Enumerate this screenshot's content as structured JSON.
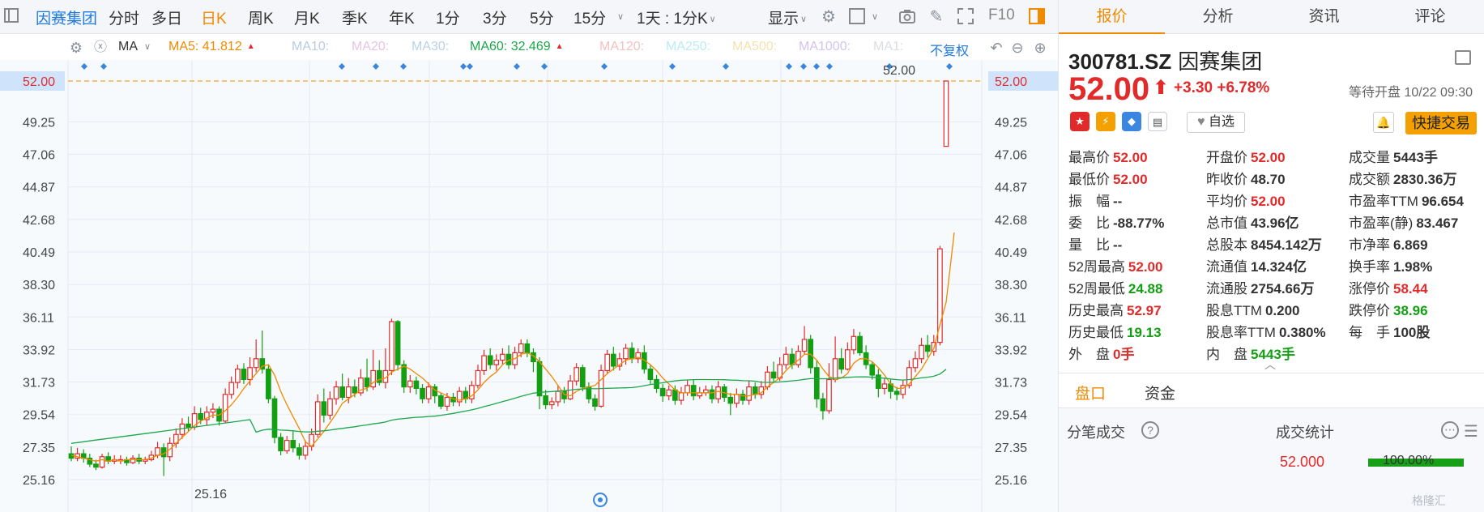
{
  "toolbar": {
    "items": [
      "因赛集团",
      "分时",
      "多日",
      "日K",
      "周K",
      "月K",
      "季K",
      "年K",
      "1分",
      "3分",
      "5分",
      "15分"
    ],
    "active": "日K",
    "period_select": "1天 : 1分K",
    "display": "显示",
    "f10": "F10"
  },
  "ma": {
    "label": "MA",
    "items": [
      {
        "text": "MA5: 41.812",
        "color": "#f08a00",
        "tri": "▲"
      },
      {
        "text": "MA10:",
        "color": "#b9cbe6",
        "tri": ""
      },
      {
        "text": "MA20:",
        "color": "#e6c4e6",
        "tri": ""
      },
      {
        "text": "MA30:",
        "color": "#b9d2e6",
        "tri": ""
      },
      {
        "text": "MA60: 32.469",
        "color": "#1aa84a",
        "tri": "▲"
      },
      {
        "text": "MA120:",
        "color": "#f4c2c2",
        "tri": ""
      },
      {
        "text": "MA250:",
        "color": "#b9ecf4",
        "tri": ""
      },
      {
        "text": "MA500:",
        "color": "#f4e2b0",
        "tri": ""
      },
      {
        "text": "MA1000:",
        "color": "#d2c4ec",
        "tri": ""
      },
      {
        "text": "MA1:",
        "color": "#dadde2",
        "tri": ""
      }
    ],
    "fuquan": "不复权"
  },
  "chart_data": {
    "type": "candlestick",
    "price_line": "52.00",
    "y_ticks": [
      "52.00",
      "49.25",
      "47.06",
      "44.87",
      "42.68",
      "40.49",
      "38.30",
      "36.11",
      "33.92",
      "31.73",
      "29.54",
      "27.35",
      "25.16"
    ],
    "max_label": "52.00",
    "min_label": "25.16",
    "ylim": [
      25.16,
      52.0
    ],
    "colors": {
      "up": "#e12b2b",
      "down": "#12a012",
      "ma5": "#f08a00",
      "ma60": "#1aa84a"
    },
    "ohlc": [
      [
        26.9,
        26.6,
        27.4,
        26.4
      ],
      [
        26.6,
        26.9,
        27.3,
        26.4
      ],
      [
        26.9,
        26.6,
        27.2,
        26.3
      ],
      [
        26.6,
        26.2,
        26.9,
        26.0
      ],
      [
        26.2,
        26.0,
        26.5,
        25.8
      ],
      [
        26.0,
        26.7,
        26.9,
        25.9
      ],
      [
        26.7,
        26.4,
        27.0,
        26.2
      ],
      [
        26.4,
        26.5,
        26.8,
        26.2
      ],
      [
        26.5,
        26.5,
        26.8,
        26.2
      ],
      [
        26.5,
        26.3,
        26.7,
        26.1
      ],
      [
        26.3,
        26.6,
        26.8,
        26.2
      ],
      [
        26.6,
        26.4,
        26.9,
        26.2
      ],
      [
        26.4,
        26.5,
        26.7,
        26.2
      ],
      [
        26.5,
        26.8,
        27.1,
        26.4
      ],
      [
        26.8,
        27.3,
        27.7,
        26.6
      ],
      [
        27.3,
        26.7,
        27.6,
        25.4
      ],
      [
        26.7,
        27.6,
        28.0,
        26.4
      ],
      [
        27.6,
        28.2,
        28.6,
        27.3
      ],
      [
        28.2,
        28.9,
        29.3,
        27.9
      ],
      [
        28.9,
        28.7,
        29.4,
        28.4
      ],
      [
        28.7,
        29.6,
        30.1,
        28.5
      ],
      [
        29.6,
        29.2,
        30.0,
        28.9
      ],
      [
        29.2,
        29.7,
        30.1,
        28.8
      ],
      [
        29.7,
        29.9,
        30.3,
        29.3
      ],
      [
        29.9,
        29.1,
        30.1,
        28.8
      ],
      [
        29.1,
        30.9,
        31.3,
        29.0
      ],
      [
        30.9,
        31.7,
        32.1,
        30.6
      ],
      [
        31.7,
        32.6,
        32.9,
        31.3
      ],
      [
        32.6,
        31.9,
        33.0,
        31.6
      ],
      [
        31.9,
        32.7,
        33.4,
        31.5
      ],
      [
        32.7,
        33.3,
        34.6,
        32.4
      ],
      [
        33.3,
        32.6,
        35.2,
        32.3
      ],
      [
        32.6,
        30.6,
        32.9,
        30.3
      ],
      [
        30.6,
        28.0,
        30.8,
        27.6
      ],
      [
        28.0,
        27.1,
        28.3,
        26.8
      ],
      [
        27.1,
        27.8,
        28.1,
        26.9
      ],
      [
        27.8,
        27.3,
        28.4,
        27.0
      ],
      [
        27.3,
        26.8,
        27.6,
        26.5
      ],
      [
        26.8,
        27.4,
        27.8,
        26.5
      ],
      [
        27.4,
        28.2,
        28.6,
        27.1
      ],
      [
        28.2,
        30.4,
        30.9,
        28.0
      ],
      [
        30.4,
        29.5,
        31.3,
        29.0
      ],
      [
        29.5,
        30.6,
        31.1,
        29.2
      ],
      [
        30.6,
        31.4,
        31.8,
        30.2
      ],
      [
        31.4,
        30.7,
        32.3,
        30.5
      ],
      [
        30.7,
        31.4,
        32.0,
        30.3
      ],
      [
        31.4,
        31.0,
        31.9,
        30.7
      ],
      [
        31.0,
        32.0,
        32.6,
        30.8
      ],
      [
        32.0,
        31.4,
        33.3,
        31.1
      ],
      [
        31.4,
        32.5,
        33.9,
        31.2
      ],
      [
        32.5,
        31.7,
        33.2,
        31.5
      ],
      [
        31.7,
        32.5,
        34.0,
        31.3
      ],
      [
        32.5,
        35.8,
        36.0,
        32.2
      ],
      [
        35.8,
        32.9,
        35.9,
        32.5
      ],
      [
        32.9,
        31.4,
        33.2,
        31.0
      ],
      [
        31.4,
        31.8,
        32.2,
        31.0
      ],
      [
        31.8,
        31.3,
        32.1,
        30.9
      ],
      [
        31.3,
        30.6,
        31.6,
        30.3
      ],
      [
        30.6,
        31.4,
        31.7,
        30.3
      ],
      [
        31.4,
        30.8,
        31.6,
        30.3
      ],
      [
        30.8,
        30.1,
        31.0,
        29.9
      ],
      [
        30.1,
        30.7,
        31.0,
        29.8
      ],
      [
        30.7,
        30.4,
        31.0,
        30.1
      ],
      [
        30.4,
        31.1,
        31.4,
        30.1
      ],
      [
        31.1,
        30.6,
        31.4,
        30.3
      ],
      [
        30.6,
        31.5,
        31.8,
        30.3
      ],
      [
        31.5,
        32.5,
        32.9,
        31.3
      ],
      [
        32.5,
        33.5,
        33.9,
        32.2
      ],
      [
        33.5,
        32.9,
        34.0,
        32.6
      ],
      [
        32.9,
        33.2,
        33.6,
        32.5
      ],
      [
        33.2,
        33.6,
        34.0,
        32.9
      ],
      [
        33.6,
        32.9,
        34.2,
        32.6
      ],
      [
        32.9,
        33.7,
        34.1,
        32.6
      ],
      [
        33.7,
        34.3,
        34.6,
        33.4
      ],
      [
        34.3,
        33.7,
        34.6,
        33.4
      ],
      [
        33.7,
        33.1,
        34.0,
        32.4
      ],
      [
        33.1,
        30.8,
        33.4,
        29.9
      ],
      [
        30.8,
        30.2,
        31.2,
        29.9
      ],
      [
        30.2,
        30.4,
        30.7,
        29.9
      ],
      [
        30.4,
        31.1,
        31.5,
        30.1
      ],
      [
        31.1,
        30.6,
        31.4,
        30.3
      ],
      [
        30.6,
        31.8,
        32.2,
        30.5
      ],
      [
        31.8,
        32.7,
        33.0,
        31.5
      ],
      [
        32.7,
        31.4,
        32.9,
        31.1
      ],
      [
        31.4,
        30.6,
        31.7,
        30.3
      ],
      [
        30.6,
        30.1,
        30.9,
        29.8
      ],
      [
        30.1,
        32.5,
        32.9,
        30.0
      ],
      [
        32.5,
        33.6,
        33.9,
        32.3
      ],
      [
        33.6,
        32.8,
        34.1,
        32.5
      ],
      [
        32.8,
        33.3,
        33.7,
        32.5
      ],
      [
        33.3,
        34.0,
        34.3,
        32.9
      ],
      [
        34.0,
        33.3,
        34.4,
        33.0
      ],
      [
        33.3,
        33.7,
        34.0,
        33.0
      ],
      [
        33.7,
        32.6,
        34.2,
        32.3
      ],
      [
        32.6,
        31.9,
        32.9,
        31.6
      ],
      [
        31.9,
        31.3,
        32.2,
        31.0
      ],
      [
        31.3,
        30.8,
        31.6,
        30.4
      ],
      [
        30.8,
        31.2,
        31.5,
        30.5
      ],
      [
        31.2,
        30.5,
        31.5,
        30.2
      ],
      [
        30.5,
        31.0,
        31.4,
        30.2
      ],
      [
        31.0,
        31.5,
        31.9,
        30.8
      ],
      [
        31.5,
        30.8,
        31.9,
        30.5
      ],
      [
        30.8,
        31.0,
        31.4,
        30.6
      ],
      [
        31.0,
        31.2,
        31.5,
        30.8
      ],
      [
        31.2,
        30.6,
        31.5,
        30.3
      ],
      [
        30.6,
        31.4,
        31.8,
        30.3
      ],
      [
        31.4,
        30.7,
        31.6,
        30.4
      ],
      [
        30.7,
        30.3,
        31.0,
        29.5
      ],
      [
        30.3,
        30.9,
        31.3,
        30.0
      ],
      [
        30.9,
        30.5,
        31.2,
        30.2
      ],
      [
        30.5,
        31.4,
        31.8,
        30.2
      ],
      [
        31.4,
        30.9,
        31.7,
        30.6
      ],
      [
        30.9,
        31.4,
        31.8,
        30.6
      ],
      [
        31.4,
        32.4,
        32.8,
        31.2
      ],
      [
        32.4,
        32.0,
        33.1,
        31.7
      ],
      [
        32.0,
        32.9,
        33.4,
        31.8
      ],
      [
        32.9,
        33.6,
        34.1,
        32.6
      ],
      [
        33.6,
        32.9,
        34.0,
        32.6
      ],
      [
        32.9,
        33.8,
        34.2,
        32.7
      ],
      [
        33.8,
        34.6,
        35.5,
        33.6
      ],
      [
        34.6,
        32.7,
        34.9,
        32.3
      ],
      [
        32.7,
        30.6,
        33.2,
        30.0
      ],
      [
        30.6,
        29.8,
        31.0,
        29.2
      ],
      [
        29.8,
        31.9,
        33.0,
        29.6
      ],
      [
        31.9,
        33.3,
        34.8,
        31.7
      ],
      [
        33.3,
        32.6,
        34.0,
        32.3
      ],
      [
        32.6,
        33.9,
        34.4,
        32.5
      ],
      [
        33.9,
        34.8,
        35.3,
        33.6
      ],
      [
        34.8,
        33.7,
        35.1,
        33.5
      ],
      [
        33.7,
        32.9,
        34.2,
        32.6
      ],
      [
        32.9,
        32.2,
        33.1,
        31.9
      ],
      [
        32.2,
        31.3,
        32.6,
        30.7
      ],
      [
        31.3,
        31.6,
        32.0,
        30.9
      ],
      [
        31.6,
        31.1,
        31.9,
        30.6
      ],
      [
        31.1,
        30.9,
        31.4,
        30.5
      ],
      [
        30.9,
        31.5,
        31.9,
        30.6
      ],
      [
        31.5,
        32.7,
        33.2,
        31.3
      ],
      [
        32.7,
        33.3,
        33.8,
        32.4
      ],
      [
        33.3,
        34.2,
        34.7,
        33.0
      ],
      [
        34.2,
        33.8,
        34.9,
        33.4
      ],
      [
        33.8,
        34.4,
        34.9,
        33.5
      ],
      [
        34.4,
        40.7,
        40.9,
        34.2
      ],
      [
        47.6,
        52.0,
        52.0,
        47.6
      ]
    ],
    "ma5": [
      26.8,
      26.7,
      26.6,
      26.5,
      26.4,
      26.5,
      26.4,
      26.5,
      26.4,
      26.5,
      26.5,
      26.5,
      26.5,
      26.6,
      26.8,
      26.9,
      27.2,
      27.6,
      28.0,
      28.4,
      28.8,
      29.1,
      29.3,
      29.5,
      29.5,
      29.8,
      30.2,
      30.7,
      31.3,
      31.8,
      32.3,
      32.8,
      32.9,
      32.2,
      31.1,
      30.2,
      29.4,
      28.6,
      27.7,
      27.4,
      27.9,
      28.4,
      29.0,
      29.6,
      30.3,
      30.6,
      30.9,
      31.2,
      31.3,
      31.7,
      31.9,
      32.0,
      32.4,
      32.6,
      32.8,
      32.6,
      32.3,
      32.0,
      31.6,
      31.2,
      31.0,
      30.8,
      30.6,
      30.5,
      30.6,
      30.8,
      31.2,
      31.7,
      32.1,
      32.4,
      32.9,
      33.2,
      33.3,
      33.6,
      33.7,
      33.5,
      33.1,
      32.6,
      32.1,
      31.5,
      30.9,
      30.8,
      31.1,
      31.3,
      31.4,
      31.5,
      31.9,
      32.3,
      32.6,
      32.9,
      33.2,
      33.3,
      33.4,
      33.2,
      32.9,
      32.5,
      32.0,
      31.6,
      31.2,
      31.0,
      31.0,
      31.0,
      31.0,
      31.0,
      31.0,
      31.1,
      31.0,
      30.9,
      30.9,
      30.8,
      30.8,
      30.9,
      31.0,
      31.4,
      31.7,
      32.0,
      32.5,
      32.9,
      33.2,
      33.6,
      33.6,
      33.2,
      32.6,
      32.1,
      31.9,
      32.0,
      32.3,
      33.0,
      33.3,
      33.3,
      33.1,
      32.7,
      32.2,
      31.6,
      31.3,
      31.3,
      31.6,
      32.1,
      32.6,
      33.3,
      34.0,
      35.6,
      37.1
    ]
  },
  "right": {
    "tabs": [
      "报价",
      "分析",
      "资讯",
      "评论"
    ],
    "active_tab": "报价",
    "code": "300781.SZ",
    "name": "因赛集团",
    "price": "52.00",
    "change": "+3.30",
    "change_pct": "+6.78%",
    "status": "等待开盘 10/22 09:30",
    "zixuan": "自选",
    "trade": "快捷交易",
    "grid": [
      [
        {
          "l": "最高价",
          "v": "52.00",
          "c": "red"
        },
        {
          "l": "开盘价",
          "v": "52.00",
          "c": "red"
        },
        {
          "l": "成交量",
          "v": "5443手",
          "c": ""
        }
      ],
      [
        {
          "l": "最低价",
          "v": "52.00",
          "c": "red"
        },
        {
          "l": "昨收价",
          "v": "48.70",
          "c": ""
        },
        {
          "l": "成交额",
          "v": "2830.36万",
          "c": ""
        }
      ],
      [
        {
          "l": "振　幅",
          "v": "--",
          "c": ""
        },
        {
          "l": "平均价",
          "v": "52.00",
          "c": "red"
        },
        {
          "l": "市盈率TTM",
          "v": "96.654",
          "c": ""
        }
      ],
      [
        {
          "l": "委　比",
          "v": "-88.77%",
          "c": ""
        },
        {
          "l": "总市值",
          "v": "43.96亿",
          "c": ""
        },
        {
          "l": "市盈率(静)",
          "v": "83.467",
          "c": ""
        }
      ],
      [
        {
          "l": "量　比",
          "v": "--",
          "c": ""
        },
        {
          "l": "总股本",
          "v": "8454.142万",
          "c": ""
        },
        {
          "l": "市净率",
          "v": "6.869",
          "c": ""
        }
      ],
      [
        {
          "l": "52周最高",
          "v": "52.00",
          "c": "red"
        },
        {
          "l": "流通值",
          "v": "14.324亿",
          "c": ""
        },
        {
          "l": "换手率",
          "v": "1.98%",
          "c": ""
        }
      ],
      [
        {
          "l": "52周最低",
          "v": "24.88",
          "c": "green"
        },
        {
          "l": "流通股",
          "v": "2754.66万",
          "c": ""
        },
        {
          "l": "涨停价",
          "v": "58.44",
          "c": "red"
        }
      ],
      [
        {
          "l": "历史最高",
          "v": "52.97",
          "c": "red"
        },
        {
          "l": "股息TTM",
          "v": "0.200",
          "c": ""
        },
        {
          "l": "跌停价",
          "v": "38.96",
          "c": "green"
        }
      ],
      [
        {
          "l": "历史最低",
          "v": "19.13",
          "c": "green"
        },
        {
          "l": "股息率TTM",
          "v": "0.380%",
          "c": ""
        },
        {
          "l": "每　手",
          "v": "100股",
          "c": ""
        }
      ],
      [
        {
          "l": "外　盘",
          "v": "0手",
          "c": "red"
        },
        {
          "l": "内　盘",
          "v": "5443手",
          "c": "green"
        },
        {
          "l": "",
          "v": "",
          "c": ""
        }
      ]
    ],
    "subtabs": [
      "盘口",
      "资金"
    ],
    "tick_label": "分笔成交",
    "stat_label": "成交统计",
    "stat_price": "52.000",
    "stat_pct": "100.00%",
    "watermark": "格隆汇"
  }
}
